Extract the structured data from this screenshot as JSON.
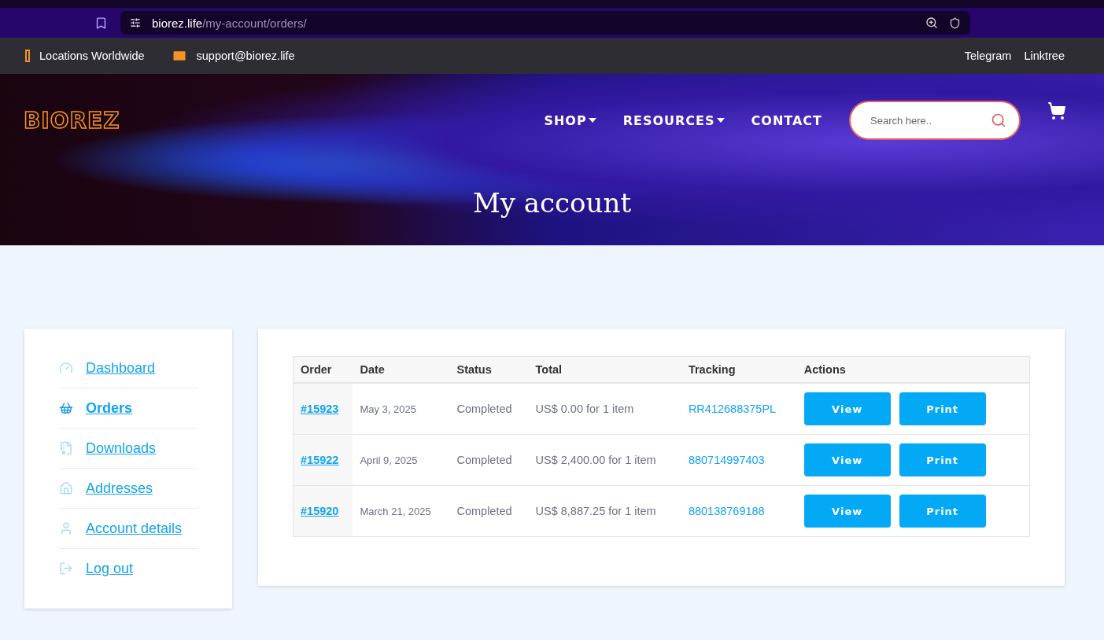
{
  "browser": {
    "url_host": "biorez.life",
    "url_path": "/my-account/orders/"
  },
  "topbar": {
    "location": "Locations Worldwide",
    "email": "support@biorez.life",
    "links": [
      "Telegram",
      "Linktree"
    ]
  },
  "header": {
    "logo": "BIOREZ",
    "nav": [
      {
        "label": "SHOP",
        "dropdown": true
      },
      {
        "label": "RESOURCES",
        "dropdown": true
      },
      {
        "label": "CONTACT",
        "dropdown": false
      }
    ],
    "search": {
      "placeholder": "Search here.."
    },
    "title": "My account"
  },
  "sidebar": {
    "items": [
      {
        "label": " Dashboard",
        "selected": false
      },
      {
        "label": " Orders",
        "selected": true
      },
      {
        "label": " Downloads",
        "selected": false
      },
      {
        "label": " Addresses",
        "selected": false
      },
      {
        "label": " Account details",
        "selected": false
      },
      {
        "label": " Log out",
        "selected": false
      }
    ]
  },
  "table": {
    "columns": [
      "Order",
      "Date",
      "Status",
      "Total",
      "Tracking",
      "Actions"
    ],
    "rows": [
      {
        "order": "#15923",
        "date": "May 3, 2025",
        "status": "Completed",
        "total": "US$ 0.00 for 1 item",
        "tracking": "RR412688375PL",
        "actions": [
          "View",
          "Print"
        ]
      },
      {
        "order": "#15922",
        "date": "April 9, 2025",
        "status": "Completed",
        "total": "US$ 2,400.00 for 1 item",
        "tracking": "880714997403",
        "actions": [
          "View",
          "Print"
        ]
      },
      {
        "order": "#15920",
        "date": "March 21, 2025",
        "status": "Completed",
        "total": "US$ 8,887.25 for 1 item",
        "tracking": "880138769188",
        "actions": [
          "View",
          "Print"
        ]
      }
    ]
  }
}
